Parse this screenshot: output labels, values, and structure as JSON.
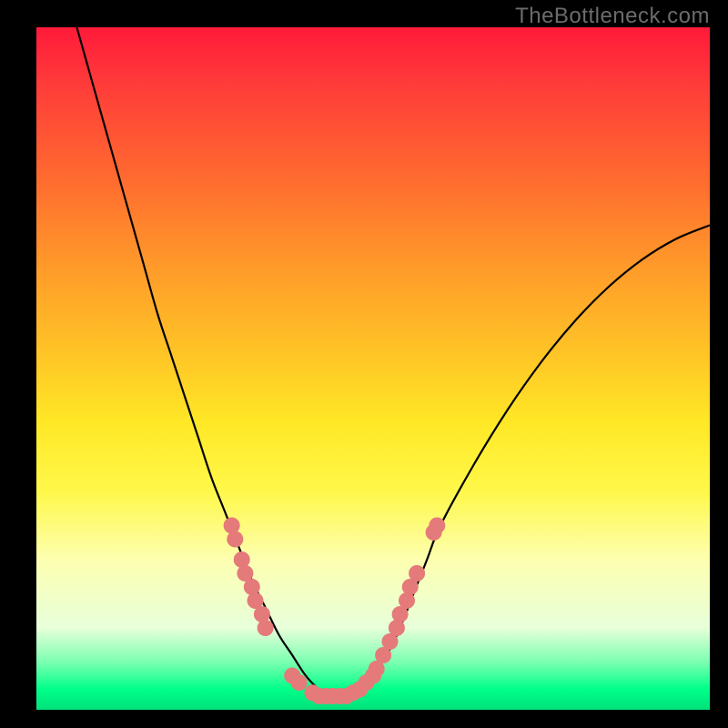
{
  "watermark": "TheBottleneck.com",
  "colors": {
    "background": "#000000",
    "curve_stroke": "#000000",
    "marker_fill": "#e47a7a",
    "gradient_top": "#ff1a3a",
    "gradient_bottom": "#00e07a"
  },
  "chart_data": {
    "type": "line",
    "title": "",
    "xlabel": "",
    "ylabel": "",
    "xlim": [
      0,
      100
    ],
    "ylim": [
      0,
      100
    ],
    "grid": false,
    "legend": false,
    "series": [
      {
        "name": "bottleneck-curve",
        "x": [
          6,
          8,
          10,
          12,
          14,
          16,
          18,
          20,
          22,
          24,
          26,
          28,
          30,
          32,
          34,
          36,
          38,
          40,
          42,
          44,
          46,
          48,
          50,
          52,
          54,
          56,
          58,
          60,
          65,
          70,
          75,
          80,
          85,
          90,
          95,
          100
        ],
        "y": [
          100,
          93,
          86,
          79,
          72,
          65,
          58,
          52,
          46,
          40,
          34,
          29,
          24,
          19,
          15,
          11,
          8,
          5,
          3,
          2,
          2,
          3,
          5,
          8,
          12,
          17,
          22,
          27,
          36,
          44,
          51,
          57,
          62,
          66,
          69,
          71
        ]
      }
    ],
    "markers": [
      {
        "x": 29.0,
        "y": 27
      },
      {
        "x": 29.5,
        "y": 25
      },
      {
        "x": 30.5,
        "y": 22
      },
      {
        "x": 31.0,
        "y": 20
      },
      {
        "x": 32.0,
        "y": 18
      },
      {
        "x": 32.5,
        "y": 16
      },
      {
        "x": 33.5,
        "y": 14
      },
      {
        "x": 34.0,
        "y": 12
      },
      {
        "x": 38.0,
        "y": 5
      },
      {
        "x": 39.0,
        "y": 4
      },
      {
        "x": 41.0,
        "y": 2.5
      },
      {
        "x": 42.0,
        "y": 2
      },
      {
        "x": 43.0,
        "y": 2
      },
      {
        "x": 44.0,
        "y": 2
      },
      {
        "x": 45.0,
        "y": 2
      },
      {
        "x": 46.0,
        "y": 2
      },
      {
        "x": 47.0,
        "y": 2.5
      },
      {
        "x": 48.0,
        "y": 3
      },
      {
        "x": 49.0,
        "y": 4
      },
      {
        "x": 50.0,
        "y": 5
      },
      {
        "x": 50.5,
        "y": 6
      },
      {
        "x": 51.5,
        "y": 8
      },
      {
        "x": 52.5,
        "y": 10
      },
      {
        "x": 53.5,
        "y": 12
      },
      {
        "x": 54.0,
        "y": 14
      },
      {
        "x": 55.0,
        "y": 16
      },
      {
        "x": 55.5,
        "y": 18
      },
      {
        "x": 56.5,
        "y": 20
      },
      {
        "x": 59.0,
        "y": 26
      },
      {
        "x": 59.5,
        "y": 27
      }
    ]
  }
}
